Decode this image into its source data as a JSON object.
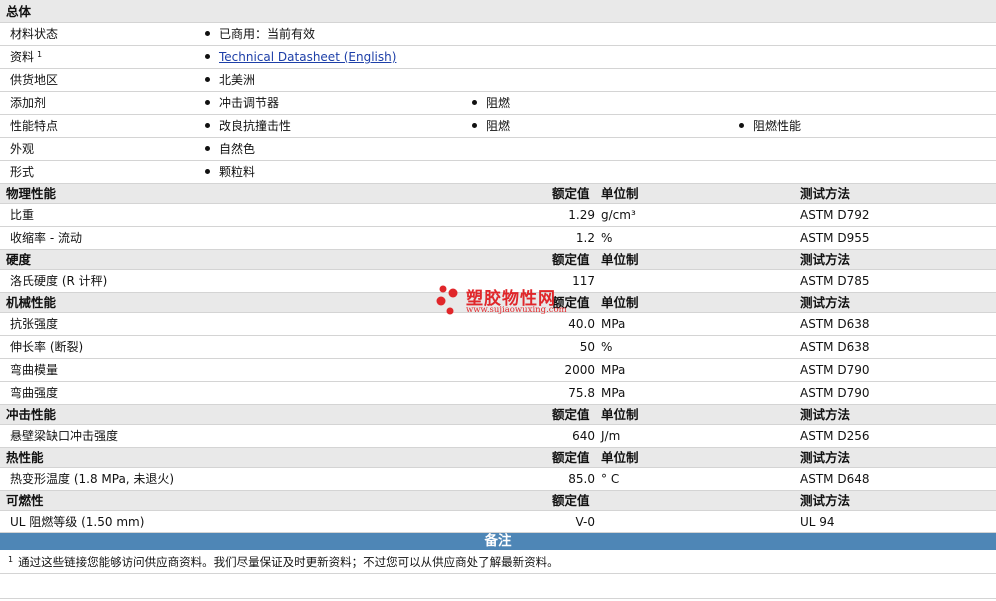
{
  "general": {
    "title": "总体",
    "rows": [
      {
        "label": "材料状态",
        "items": [
          "已商用：当前有效"
        ]
      },
      {
        "label": "资料",
        "footnote": "1",
        "link": "Technical Datasheet (English)"
      },
      {
        "label": "供货地区",
        "items": [
          "北美洲"
        ]
      },
      {
        "label": "添加剂",
        "items": [
          "冲击调节器",
          "阻燃"
        ]
      },
      {
        "label": "性能特点",
        "items": [
          "改良抗撞击性",
          "阻燃",
          "阻燃性能"
        ]
      },
      {
        "label": "外观",
        "items": [
          "自然色"
        ]
      },
      {
        "label": "形式",
        "items": [
          "颗粒料"
        ]
      }
    ]
  },
  "headers": {
    "nominal": "额定值",
    "unit": "单位制",
    "method": "测试方法"
  },
  "physical": {
    "title": "物理性能",
    "rows": [
      {
        "name": "比重",
        "value": "1.29",
        "unit": "g/cm³",
        "method": "ASTM D792"
      },
      {
        "name": "收缩率 - 流动",
        "value": "1.2",
        "unit": "%",
        "method": "ASTM D955"
      }
    ]
  },
  "hardness": {
    "title": "硬度",
    "rows": [
      {
        "name": "洛氏硬度 (R 计秤)",
        "value": "117",
        "unit": "",
        "method": "ASTM D785"
      }
    ]
  },
  "mechanical": {
    "title": "机械性能",
    "rows": [
      {
        "name": "抗张强度",
        "value": "40.0",
        "unit": "MPa",
        "method": "ASTM D638"
      },
      {
        "name": "伸长率 (断裂)",
        "value": "50",
        "unit": "%",
        "method": "ASTM D638"
      },
      {
        "name": "弯曲模量",
        "value": "2000",
        "unit": "MPa",
        "method": "ASTM D790"
      },
      {
        "name": "弯曲强度",
        "value": "75.8",
        "unit": "MPa",
        "method": "ASTM D790"
      }
    ]
  },
  "impact": {
    "title": "冲击性能",
    "rows": [
      {
        "name": "悬壁梁缺口冲击强度",
        "value": "640",
        "unit": "J/m",
        "method": "ASTM D256"
      }
    ]
  },
  "thermal": {
    "title": "热性能",
    "rows": [
      {
        "name": "热变形温度 (1.8 MPa, 未退火)",
        "value": "85.0",
        "unit": "° C",
        "method": "ASTM D648"
      }
    ]
  },
  "flammability": {
    "title": "可燃性",
    "rows": [
      {
        "name": "UL 阻燃等级 (1.50 mm)",
        "value": "V-0",
        "unit": "",
        "method": "UL 94"
      }
    ]
  },
  "notes": {
    "title": "备注",
    "footnote_mark": "1",
    "footnote_text": "通过这些链接您能够访问供应商资料。我们尽量保证及时更新资料；不过您可以从供应商处了解最新资料。"
  },
  "watermark": {
    "name": "塑胶物性网",
    "url": "www.sujiaowuxing.com",
    "color": "#e0262a"
  }
}
